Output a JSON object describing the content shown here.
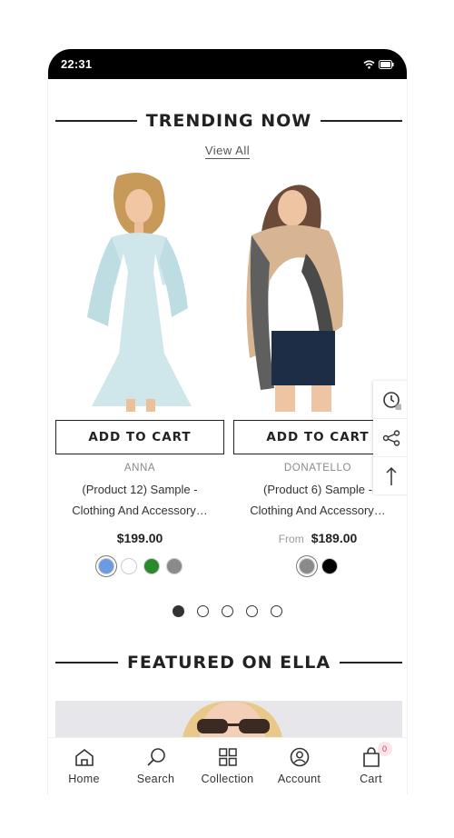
{
  "status_bar": {
    "time": "22:31"
  },
  "trending": {
    "title": "TRENDING NOW",
    "view_all": "View All",
    "products": [
      {
        "button": "ADD TO CART",
        "vendor": "ANNA",
        "name_line1": "(Product 12) Sample -",
        "name_line2": "Clothing And Accessory…",
        "price_prefix": "",
        "price": "$199.00",
        "swatches": [
          "#6a9be3",
          "#ffffff",
          "#2a8a2a",
          "#8a8a8a"
        ]
      },
      {
        "button": "ADD TO CART",
        "vendor": "DONATELLO",
        "name_line1": "(Product 6) Sample -",
        "name_line2": "Clothing And Accessory…",
        "price_prefix": "From",
        "price": "$189.00",
        "swatches": [
          "#8a8a8a",
          "#000000"
        ]
      }
    ],
    "pagination": {
      "total": 5,
      "active": 1
    }
  },
  "featured": {
    "title": "FEATURED ON ELLA"
  },
  "side_tools": [
    "recent-history-icon",
    "share-icon",
    "back-to-top-icon"
  ],
  "bottom_nav": {
    "items": [
      {
        "label": "Home",
        "icon": "home-icon"
      },
      {
        "label": "Search",
        "icon": "search-icon"
      },
      {
        "label": "Collection",
        "icon": "grid-icon"
      },
      {
        "label": "Account",
        "icon": "account-icon"
      },
      {
        "label": "Cart",
        "icon": "bag-icon"
      }
    ],
    "cart_count": "0"
  }
}
